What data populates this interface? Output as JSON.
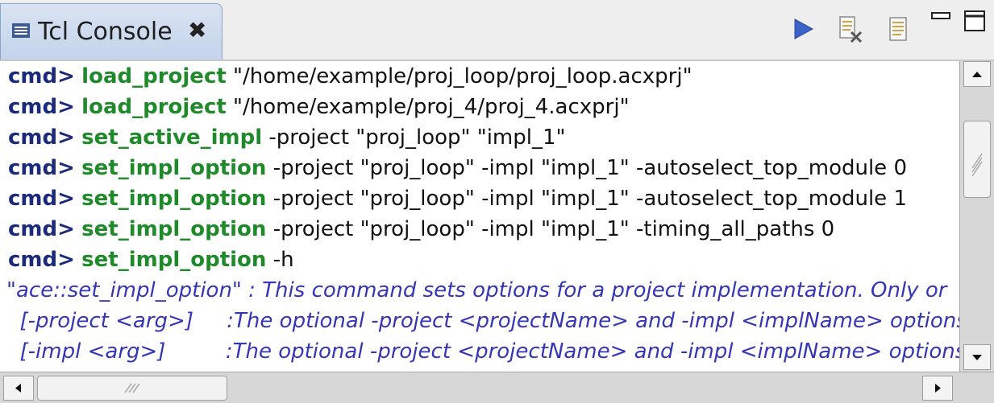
{
  "tab": {
    "title": "Tcl Console",
    "close_icon": "✖"
  },
  "toolbar": {
    "run_icon": "play-icon",
    "clear_icon": "clear-console-icon",
    "copy_icon": "document-icon",
    "minimize_icon": "minimize-icon",
    "maximize_icon": "maximize-icon"
  },
  "console": {
    "lines": [
      {
        "prompt": "cmd>",
        "command": "load_project",
        "args": " \"/home/example/proj_loop/proj_loop.acxprj\""
      },
      {
        "prompt": "cmd>",
        "command": "load_project",
        "args": " \"/home/example/proj_4/proj_4.acxprj\""
      },
      {
        "prompt": "cmd>",
        "command": "set_active_impl",
        "args": " -project \"proj_loop\" \"impl_1\""
      },
      {
        "prompt": "cmd>",
        "command": "set_impl_option",
        "args": " -project \"proj_loop\" -impl \"impl_1\" -autoselect_top_module 0"
      },
      {
        "prompt": "cmd>",
        "command": "set_impl_option",
        "args": " -project \"proj_loop\" -impl \"impl_1\" -autoselect_top_module 1"
      },
      {
        "prompt": "cmd>",
        "command": "set_impl_option",
        "args": " -project \"proj_loop\" -impl \"impl_1\" -timing_all_paths 0"
      },
      {
        "prompt": "cmd>",
        "command": "set_impl_option",
        "args": " -h"
      }
    ],
    "help_lines": [
      "\"ace::set_impl_option\" : This command sets options for a project implementation.  Only or",
      "  [-project <arg>]     :The optional -project <projectName> and -impl <implName> options",
      "  [-impl <arg>]         :The optional -project <projectName> and -impl <implName> options a"
    ]
  },
  "colors": {
    "prompt": "#1b2a7a",
    "command": "#1f8a2a",
    "help": "#3535b8"
  }
}
